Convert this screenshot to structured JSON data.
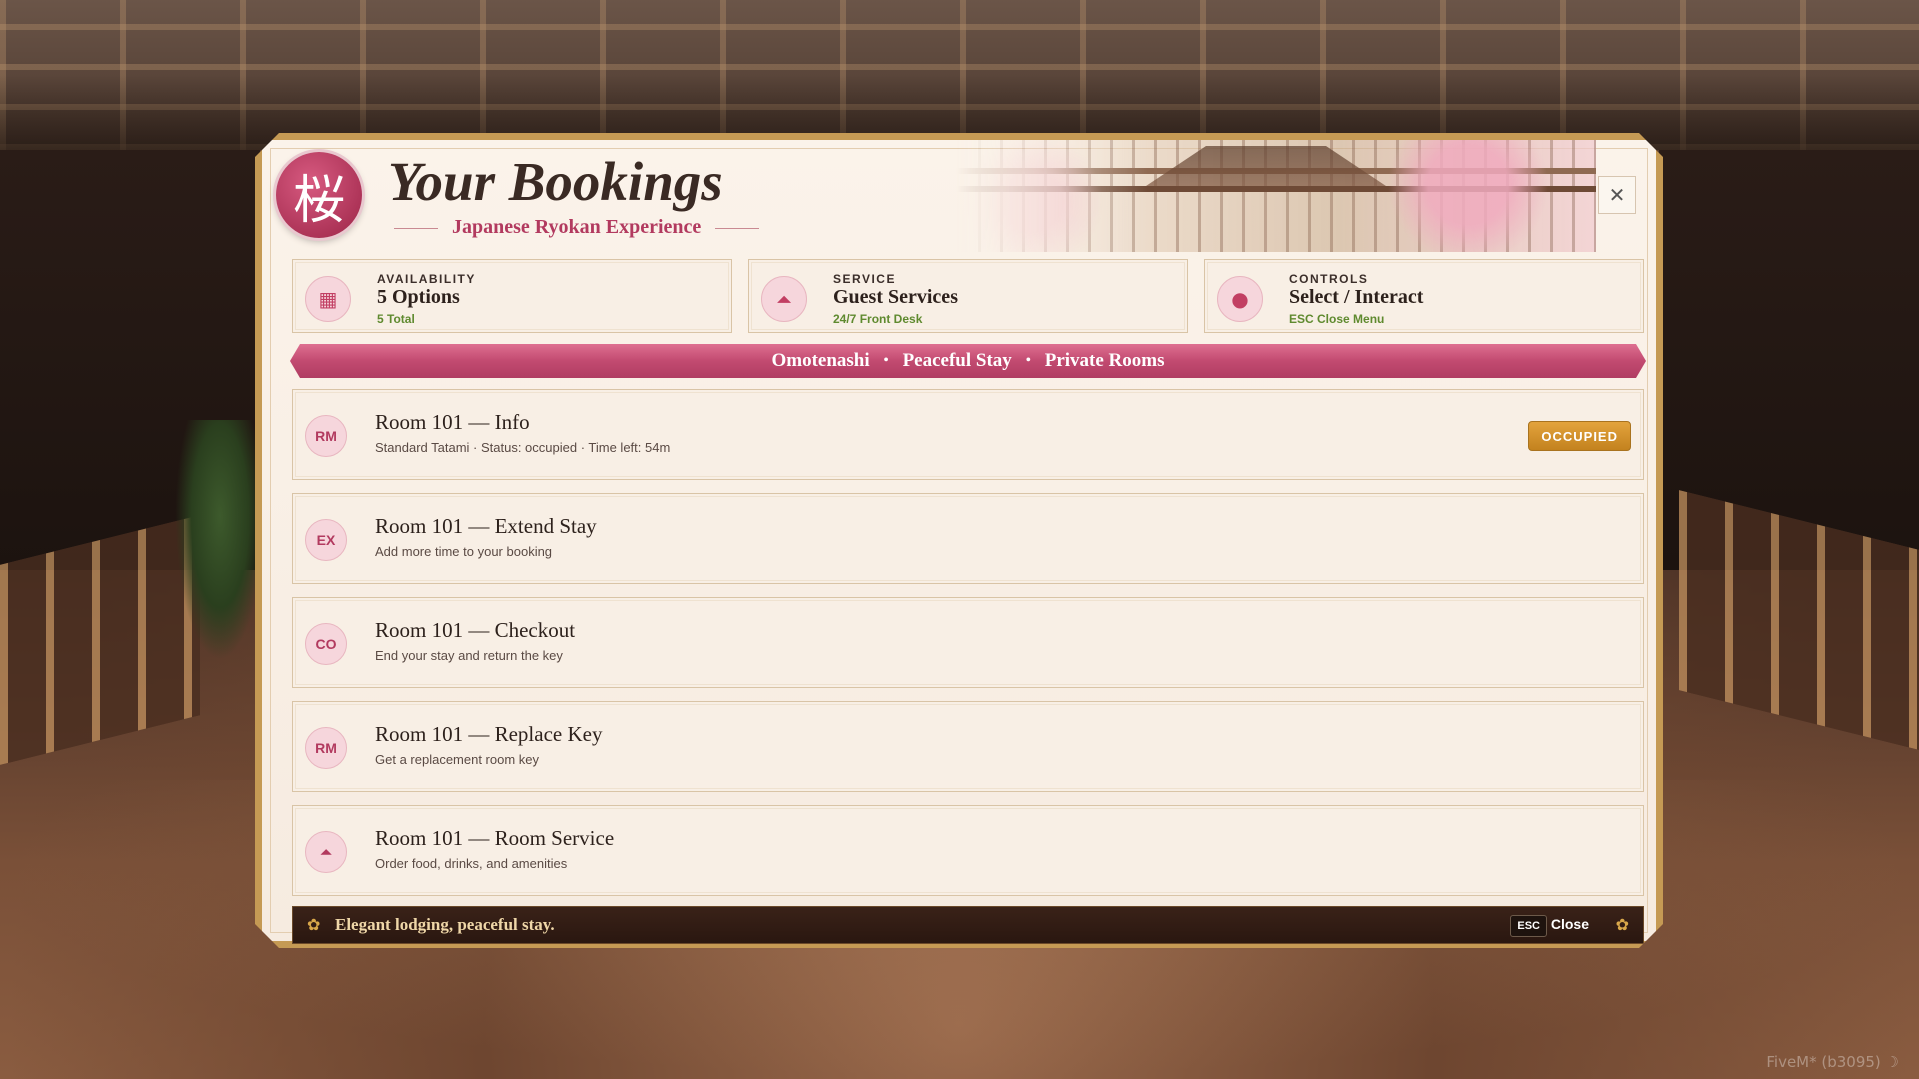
{
  "header": {
    "logo_glyph": "桜",
    "title": "Your Bookings",
    "subtitle": "Japanese Ryokan Experience",
    "close_glyph": "✕"
  },
  "cards": [
    {
      "label": "AVAILABILITY",
      "value": "5 Options",
      "sub": "5 Total",
      "icon": "calendar-icon",
      "glyph": "▦"
    },
    {
      "label": "SERVICE",
      "value": "Guest Services",
      "sub": "24/7 Front Desk",
      "icon": "service-bell-icon",
      "glyph": "⏶"
    },
    {
      "label": "CONTROLS",
      "value": "Select / Interact",
      "sub": "ESC Close Menu",
      "icon": "mouse-icon",
      "glyph": "●"
    }
  ],
  "banner": {
    "items": [
      "Omotenashi",
      "Peaceful Stay",
      "Private Rooms"
    ],
    "separator": "•"
  },
  "rows": [
    {
      "abbr": "RM",
      "title": "Room 101 — Info",
      "desc": "Standard Tatami · Status: occupied · Time left: 54m",
      "badge": "OCCUPIED"
    },
    {
      "abbr": "EX",
      "title": "Room 101 — Extend Stay",
      "desc": "Add more time to your booking"
    },
    {
      "abbr": "CO",
      "title": "Room 101 — Checkout",
      "desc": "End your stay and return the key"
    },
    {
      "abbr": "RM",
      "title": "Room 101 — Replace Key",
      "desc": "Get a replacement room key"
    },
    {
      "abbr": "⏶",
      "title": "Room 101 — Room Service",
      "desc": "Order food, drinks, and amenities"
    }
  ],
  "footer": {
    "text": "Elegant lodging, peaceful stay.",
    "esc_key": "ESC",
    "esc_label": "Close",
    "flower_glyph": "✿"
  },
  "watermark": "FiveM* (b3095) ☽",
  "colors": {
    "accent_pink": "#c24a70",
    "gold_frame": "#c59a54",
    "badge_gold": "#d99430"
  }
}
